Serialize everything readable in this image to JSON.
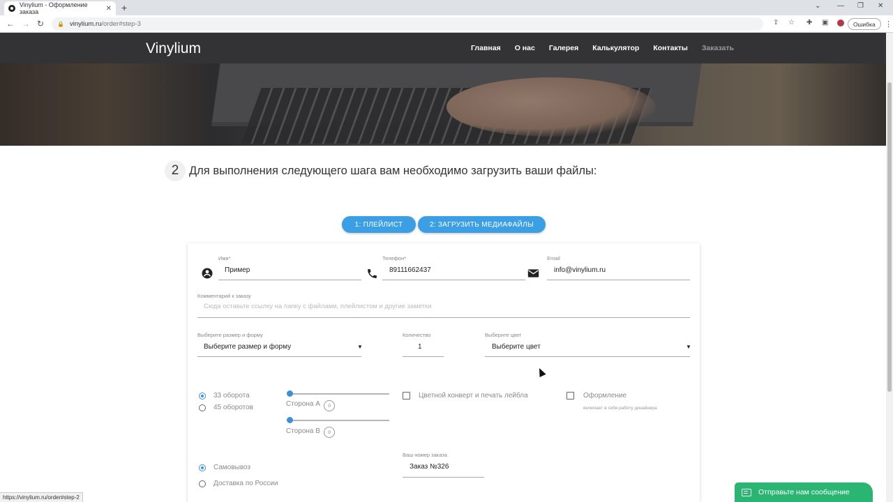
{
  "browser": {
    "tab_title": "Vinylium - Оформление заказа",
    "tab_close": "✕",
    "new_tab": "+",
    "url_host": "vinylium.ru",
    "url_path": "/order#step-3",
    "error_pill": "Ошибка",
    "status_url": "https://vinylium.ru/order#step-2"
  },
  "nav": {
    "logo": "Vinylium",
    "items": [
      "Главная",
      "О нас",
      "Галерея",
      "Калькулятор",
      "Контакты",
      "Заказать"
    ]
  },
  "step": {
    "number": "2",
    "title": "Для выполнения следующего шага вам необходимо загрузить ваши файлы:",
    "buttons": [
      "1: ПЛЕЙЛИСТ",
      "2: ЗАГРУЗИТЬ МЕДИАФАЙЛЫ"
    ]
  },
  "form": {
    "name": {
      "label": "Имя*",
      "value": "Пример"
    },
    "phone": {
      "label": "Телефон*",
      "value": "89111662437"
    },
    "email": {
      "label": "Email",
      "value": "info@vinylium.ru"
    },
    "comment": {
      "label": "Комментарий к заказу",
      "placeholder": "Сюда оставьте ссылку на папку с файлами, плейлистом и другие заметки"
    },
    "size": {
      "label": "Выберите размер и форму",
      "value": "Выберите размер и форму"
    },
    "quantity": {
      "label": "Количество",
      "value": "1"
    },
    "color": {
      "label": "Выберите цвет",
      "value": "Выберите цвет"
    },
    "speed": {
      "options": [
        "33 оборота",
        "45 оборотов"
      ],
      "selected": 0
    },
    "side_a": {
      "label": "Сторона А",
      "value": "0"
    },
    "side_b": {
      "label": "Сторона В",
      "value": "0"
    },
    "color_sleeve": {
      "label": "Цветной конверт и печать лейбла",
      "checked": false
    },
    "design": {
      "label": "Оформление",
      "sublabel": "включает в себя работу дизайнера",
      "checked": false
    },
    "delivery": {
      "options": [
        "Самовывоз",
        "Доставка по России"
      ],
      "selected": 0
    },
    "order_number": {
      "label": "Ваш номер заказа",
      "value": "Заказ №326"
    }
  },
  "chat": {
    "label": "Отправьте нам сообщение"
  },
  "colors": {
    "accent": "#3d9fe3",
    "nav_bg": "#333335",
    "chat": "#2bb573"
  }
}
